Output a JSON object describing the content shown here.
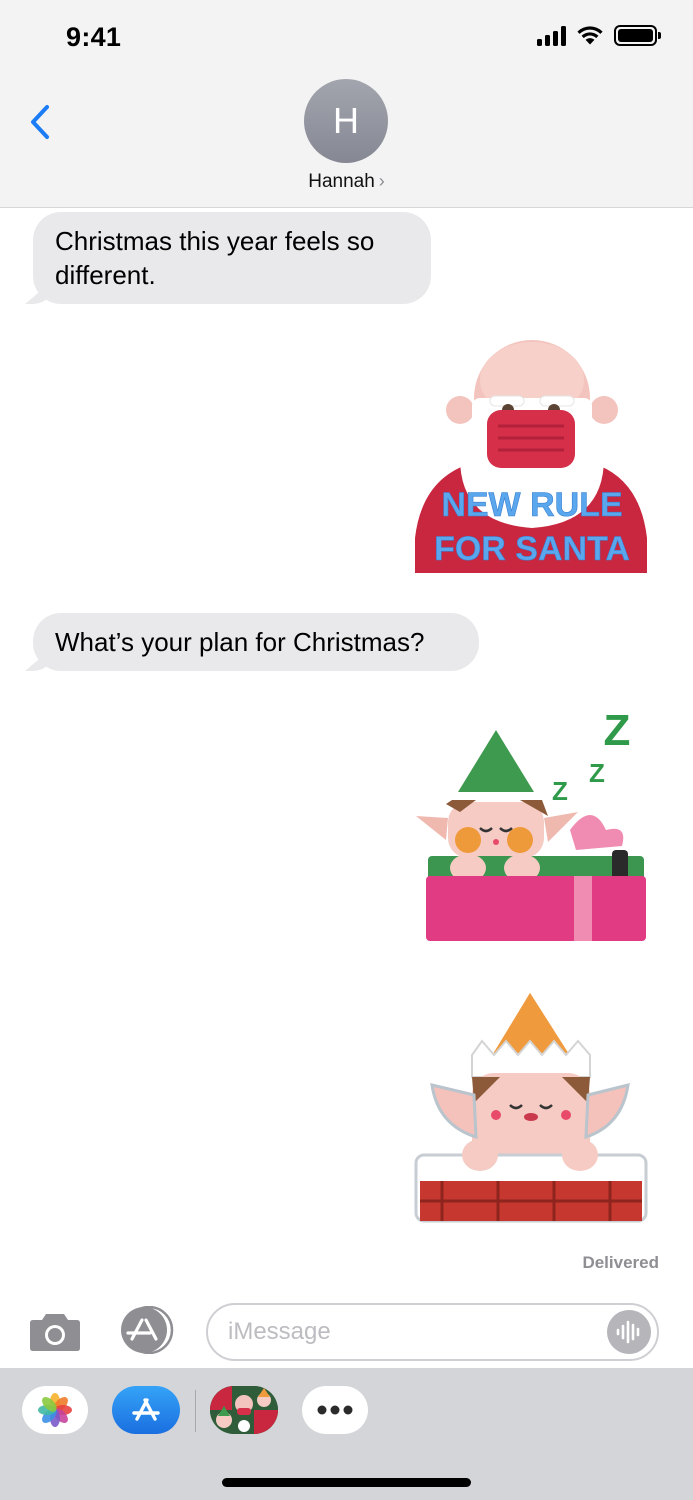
{
  "status_bar": {
    "time": "9:41",
    "icons": [
      "cellular-signal-icon",
      "wifi-icon",
      "battery-icon"
    ]
  },
  "header": {
    "back_icon": "chevron-left-icon",
    "avatar_initial": "H",
    "contact_name": "Hannah",
    "contact_chevron": "›"
  },
  "messages": [
    {
      "type": "text",
      "direction": "incoming",
      "text": "Christmas this year feels so different."
    },
    {
      "type": "sticker",
      "direction": "outgoing",
      "sticker": "masked-santa-sticker",
      "caption_line1": "NEW RULE",
      "caption_line2": "FOR SANTA"
    },
    {
      "type": "text",
      "direction": "incoming",
      "text": "What’s your plan for Christmas?"
    },
    {
      "type": "sticker",
      "direction": "outgoing",
      "sticker": "sleeping-elf-gift-sticker",
      "caption_line1": "Z",
      "caption_line2": "Z",
      "caption_line3": "Z"
    },
    {
      "type": "sticker",
      "direction": "outgoing",
      "sticker": "elf-in-chimney-sticker"
    }
  ],
  "delivery_status": "Delivered",
  "composer": {
    "placeholder": "iMessage",
    "value": "",
    "camera_icon": "camera-icon",
    "apps_icon": "app-store-icon",
    "audio_icon": "audio-waveform-icon"
  },
  "app_drawer": {
    "apps": [
      "photos-app-icon",
      "app-store-icon",
      "christmas-stickers-app-icon",
      "more-apps-icon"
    ]
  },
  "colors": {
    "incoming_bubble": "#e9e9eb",
    "ios_blue": "#1b7cf5",
    "header_bg": "#f3f3f3",
    "drawer_bg": "#d4d5d9",
    "secondary_text": "#8e8e93"
  }
}
